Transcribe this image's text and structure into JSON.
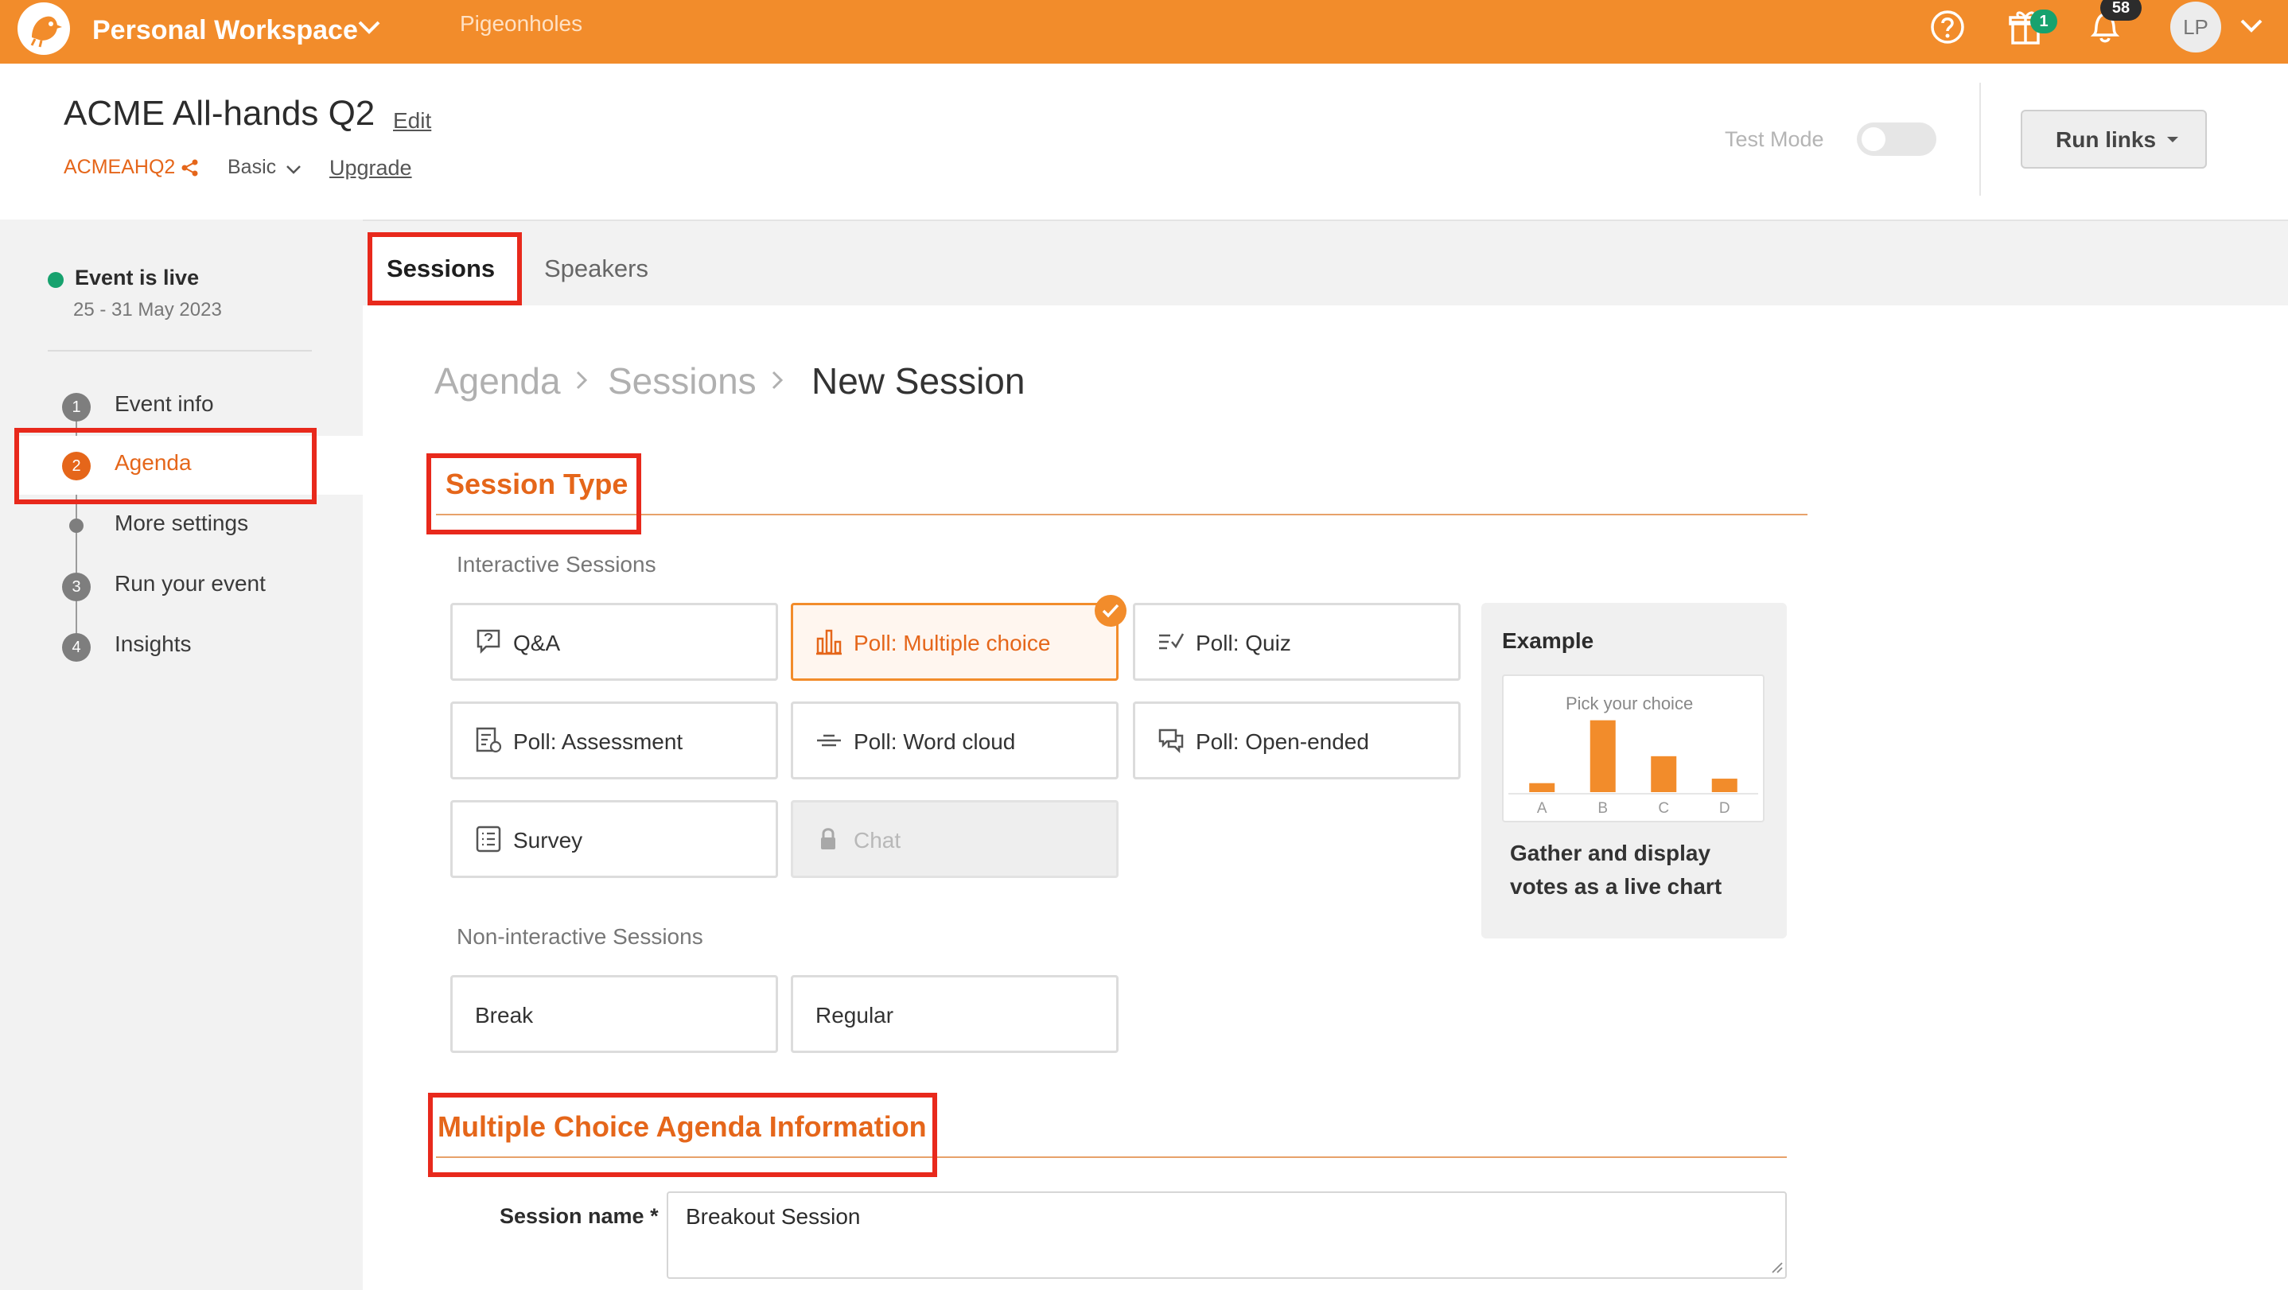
{
  "topbar": {
    "workspace_title": "Personal Workspace",
    "nav_link": "Pigeonholes",
    "gift_badge": "1",
    "notification_badge": "58",
    "avatar_initials": "LP",
    "colors": {
      "bar": "#f28c2b"
    }
  },
  "event": {
    "title": "ACME All-hands Q2",
    "edit_label": "Edit",
    "code": "ACMEAHQ2",
    "plan": "Basic",
    "upgrade_label": "Upgrade",
    "test_mode_label": "Test Mode",
    "test_mode_on": false,
    "run_links_label": "Run links"
  },
  "tabs": [
    {
      "label": "Sessions",
      "active": true
    },
    {
      "label": "Speakers",
      "active": false
    }
  ],
  "sidebar": {
    "status": "Event is live",
    "dates": "25 - 31 May 2023",
    "steps": [
      {
        "number": "1",
        "label": "Event info"
      },
      {
        "number": "2",
        "label": "Agenda",
        "active": true
      },
      {
        "number": "",
        "label": "More settings"
      },
      {
        "number": "3",
        "label": "Run your event"
      },
      {
        "number": "4",
        "label": "Insights"
      }
    ]
  },
  "breadcrumb": [
    "Agenda",
    "Sessions",
    "New Session"
  ],
  "session_type": {
    "heading": "Session Type",
    "interactive_label": "Interactive Sessions",
    "interactive": [
      {
        "label": "Q&A",
        "icon": "qa-icon"
      },
      {
        "label": "Poll: Multiple choice",
        "icon": "bar-chart-icon",
        "selected": true
      },
      {
        "label": "Poll: Quiz",
        "icon": "quiz-icon"
      },
      {
        "label": "Poll: Assessment",
        "icon": "assessment-icon"
      },
      {
        "label": "Poll: Word cloud",
        "icon": "word-cloud-icon"
      },
      {
        "label": "Poll: Open-ended",
        "icon": "chat-bubbles-icon"
      },
      {
        "label": "Survey",
        "icon": "survey-icon"
      },
      {
        "label": "Chat",
        "icon": "lock-icon",
        "disabled": true
      }
    ],
    "non_interactive_label": "Non-interactive Sessions",
    "non_interactive": [
      {
        "label": "Break"
      },
      {
        "label": "Regular"
      }
    ]
  },
  "example": {
    "title": "Example",
    "chart_title": "Pick your choice",
    "description": "Gather and display votes as a live chart"
  },
  "chart_data": {
    "type": "bar",
    "title": "Pick your choice",
    "categories": [
      "A",
      "B",
      "C",
      "D"
    ],
    "values": [
      1,
      8,
      4,
      1.5
    ],
    "ylim": [
      0,
      8.5
    ],
    "color": "#f28c2b"
  },
  "info_section": {
    "heading": "Multiple Choice Agenda Information",
    "session_name_label": "Session name *",
    "session_name_value": "Breakout Session"
  }
}
